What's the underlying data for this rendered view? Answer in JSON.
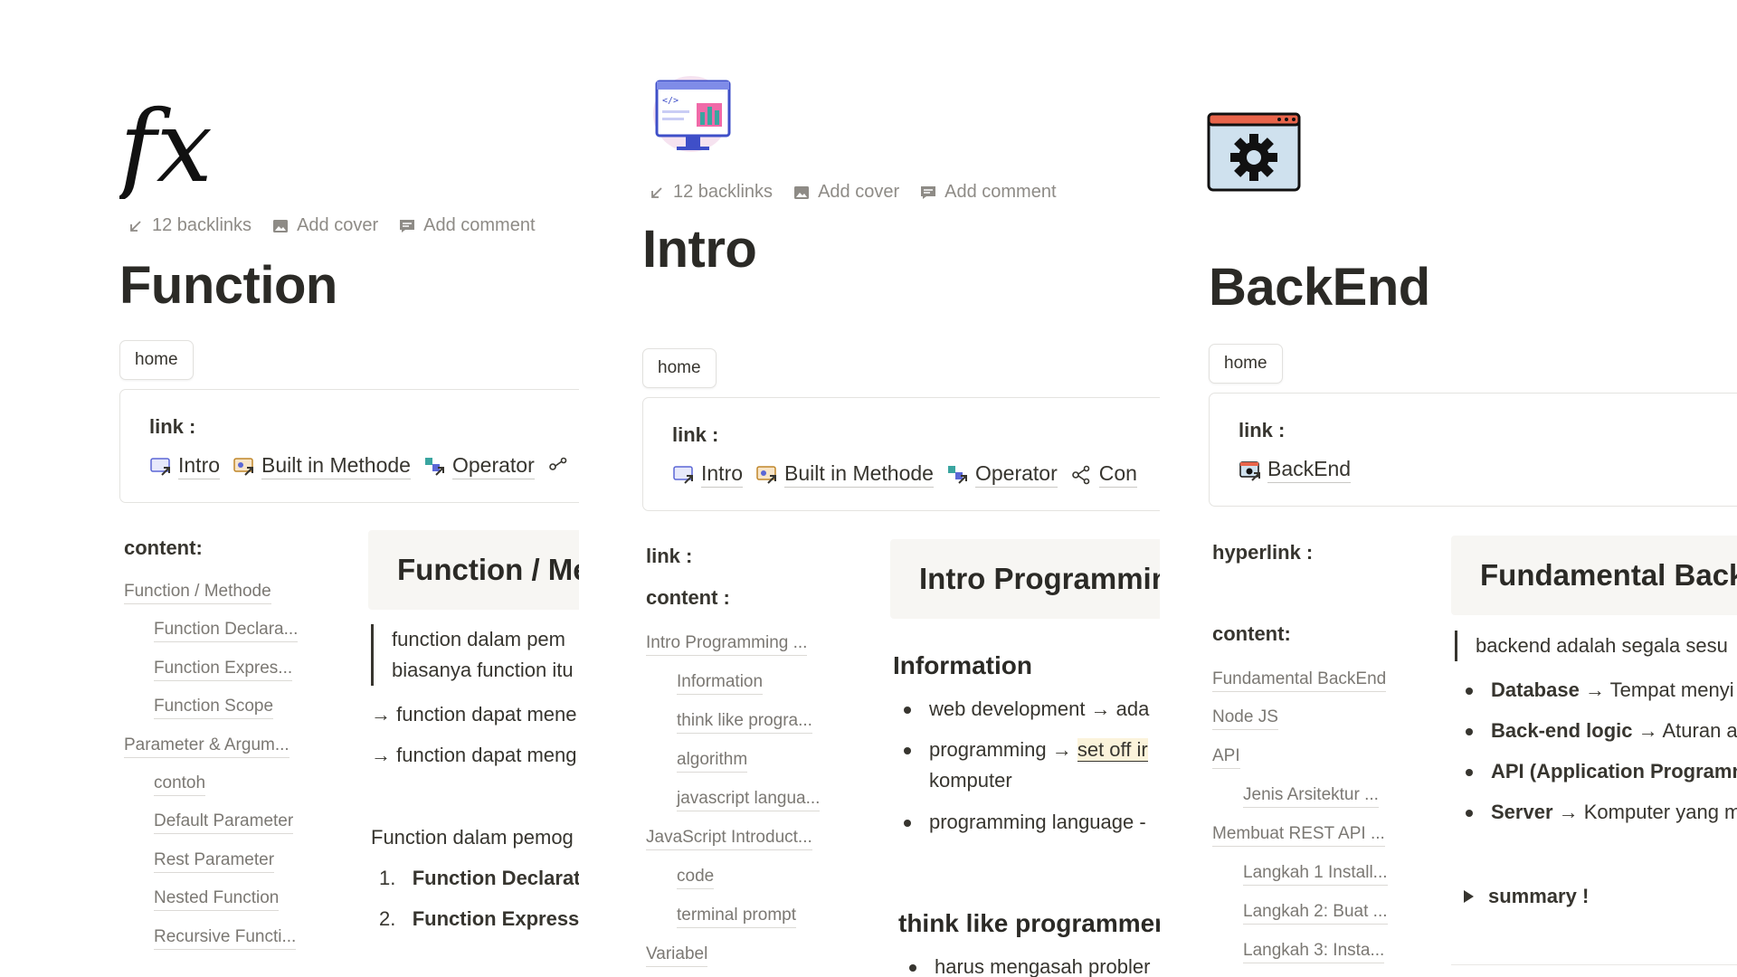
{
  "shared": {
    "backlinks": "12 backlinks",
    "add_cover": "Add cover",
    "add_comment": "Add comment",
    "home": "home",
    "link_label": "link :"
  },
  "p1": {
    "title": "Function",
    "chips": [
      "Intro",
      "Built in Methode",
      "Operator",
      ""
    ],
    "content_label": "content:",
    "toc": [
      "Function / Methode",
      "Function Declara...",
      "Function Expres...",
      "Function Scope",
      "Parameter & Argum...",
      "contoh",
      "Default Parameter",
      "Rest Parameter",
      "Nested Function",
      "Recursive Functi..."
    ],
    "callout": "Function / Me",
    "quote_lines": [
      "function dalam pem",
      "biasanya function itu"
    ],
    "arrow1": "→ function dapat mene",
    "arrow2": "→ function dapat meng",
    "para": "Function dalam pemog",
    "num1_n": "1.",
    "num1": "Function Declarati",
    "num2_n": "2.",
    "num2": "Function Expressi"
  },
  "p2": {
    "title": "Intro",
    "chips": [
      "Intro",
      "Built in Methode",
      "Operator",
      "Con"
    ],
    "link_label2": "link :",
    "content_label": "content :",
    "toc": [
      "Intro Programming ...",
      "Information",
      "think like progra...",
      "algorithm",
      "javascript langua...",
      "JavaScript Introduct...",
      "code",
      "terminal prompt",
      "Variabel"
    ],
    "callout": "Intro Programmin",
    "h_info": "Information",
    "b1": "web development → ada",
    "b2_pre": "programming → ",
    "b2_hl": "set off ir",
    "b2_cont": "komputer",
    "b3": "programming language -",
    "h_think": "think like programmer",
    "b4": "harus mengasah probler"
  },
  "p3": {
    "title": "BackEnd",
    "chips": [
      "BackEnd"
    ],
    "hyperlink_label": "hyperlink :",
    "content_label": "content:",
    "toc": [
      "Fundamental BackEnd",
      "Node JS",
      "API",
      "Jenis Arsitektur ...",
      "Membuat REST API ...",
      "Langkah 1 Install...",
      "Langkah 2: Buat ...",
      "Langkah 3: Insta..."
    ],
    "callout": "Fundamental Back",
    "quote": "backend adalah segala sesu",
    "bullets": [
      {
        "b": "Database",
        "t": " → Tempat menyi"
      },
      {
        "b": "Back-end logic",
        "t": " → Aturan an"
      },
      {
        "b": "API (Application Programn",
        "t": ""
      },
      {
        "b": "Server",
        "t": " → Komputer yang m"
      }
    ],
    "toggle": "summary !"
  }
}
